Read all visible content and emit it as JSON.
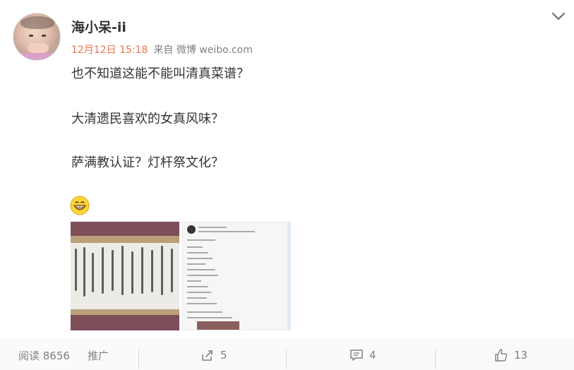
{
  "post": {
    "author": "海小呆-ii",
    "date": "12月12日 15:18",
    "source": "来自 微博 weibo.com",
    "lines": [
      "也不知道这能不能叫清真菜谱？",
      "大清遗民喜欢的女真风味？",
      "萨满教认证？灯杆祭文化？"
    ],
    "emoji": "grinning-face-emoji",
    "images": [
      "calligraphy-scroll-photo",
      "recipe-post-screenshot"
    ]
  },
  "footer": {
    "read": "阅读 8656",
    "promo": "推广",
    "repost_count": "5",
    "comment_count": "4",
    "like_count": "13"
  },
  "colors": {
    "date_accent": "#eb7350",
    "meta_gray": "#808080",
    "text": "#333333",
    "footer_bg": "#fafafa"
  }
}
